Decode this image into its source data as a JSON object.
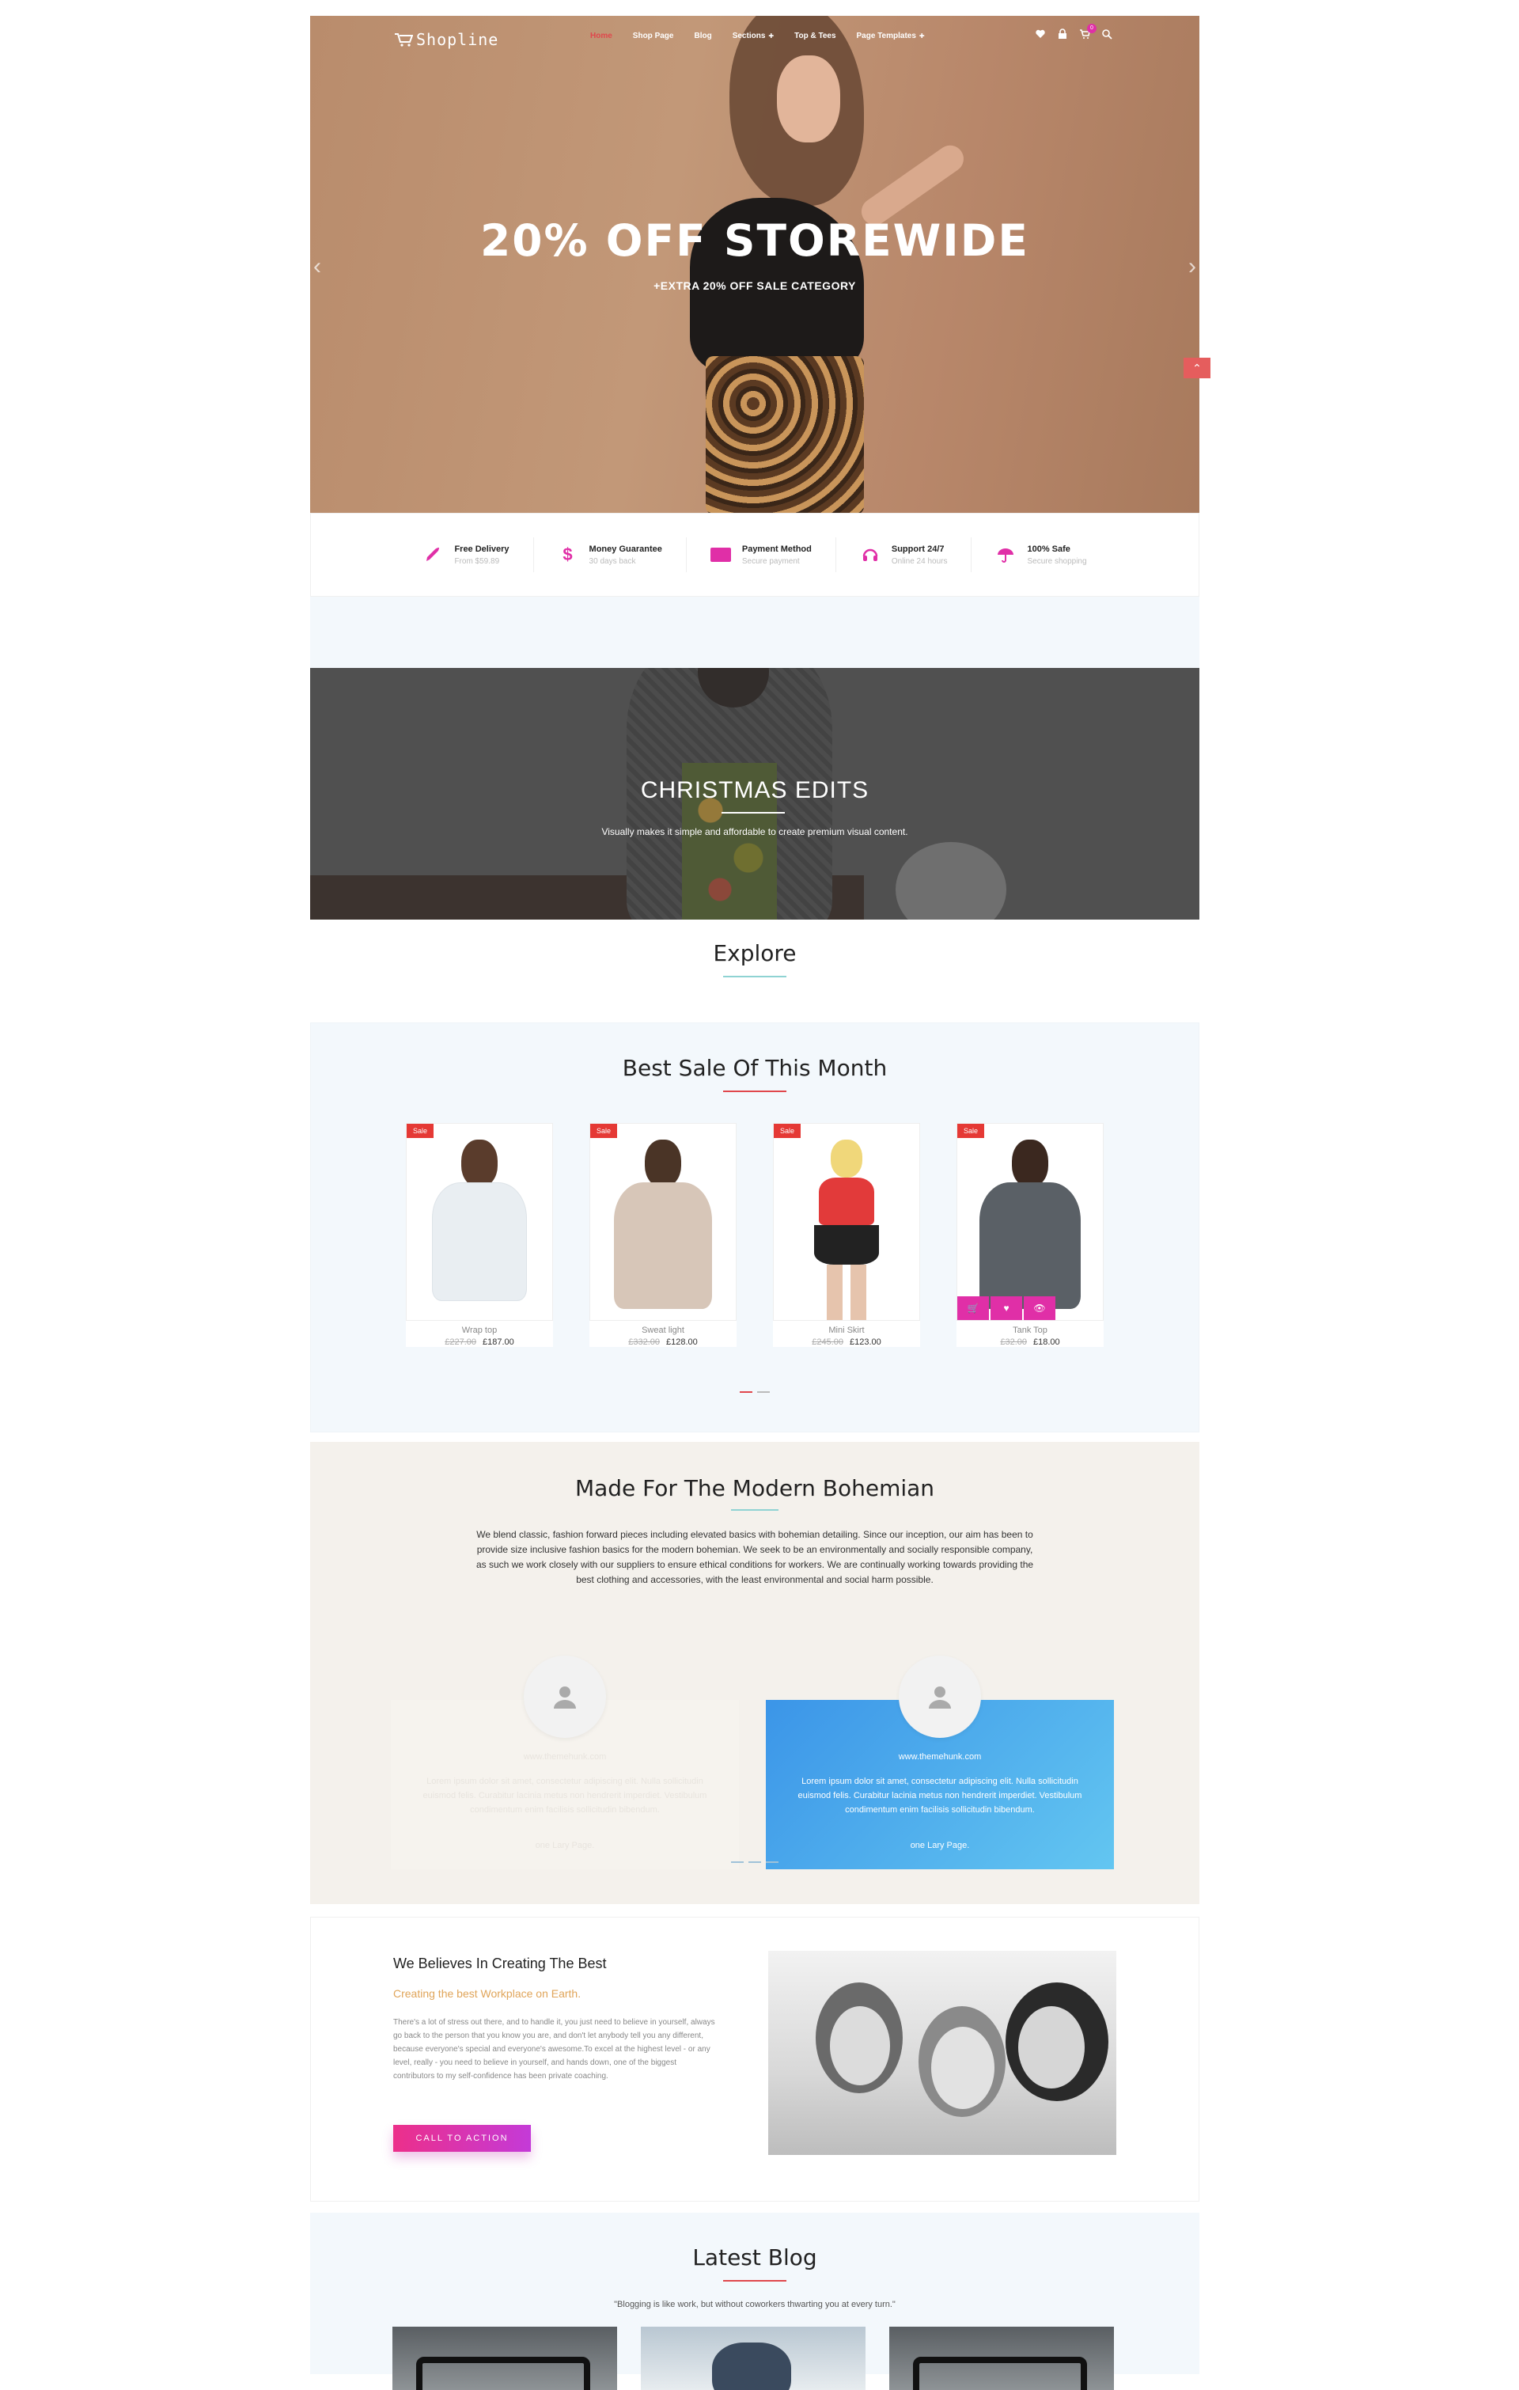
{
  "header": {
    "logo_text": "Shopline",
    "menu": [
      {
        "label": "Home",
        "active": true
      },
      {
        "label": "Shop Page"
      },
      {
        "label": "Blog"
      },
      {
        "label": "Sections",
        "has_dropdown": true
      },
      {
        "label": "Top & Tees"
      },
      {
        "label": "Page Templates",
        "has_dropdown": true
      }
    ],
    "cart_count": "0"
  },
  "hero": {
    "title": "20% OFF STOREWIDE",
    "subtitle": "+EXTRA 20% OFF SALE CATEGORY"
  },
  "features": [
    {
      "icon": "rocket-icon",
      "title": "Free Delivery",
      "sub": "From $59.89"
    },
    {
      "icon": "dollar-icon",
      "title": "Money Guarantee",
      "sub": "30 days back"
    },
    {
      "icon": "paypal-icon",
      "title": "Payment Method",
      "sub": "Secure payment"
    },
    {
      "icon": "headphones-icon",
      "title": "Support 24/7",
      "sub": "Online 24 hours"
    },
    {
      "icon": "umbrella-icon",
      "title": "100% Safe",
      "sub": "Secure shopping"
    }
  ],
  "christmas": {
    "title": "CHRISTMAS EDITS",
    "subtitle": "Visually makes it simple and affordable to create premium visual content."
  },
  "explore": {
    "title": "Explore"
  },
  "best_sale": {
    "title": "Best Sale Of This Month",
    "products": [
      {
        "badge": "Sale",
        "name": "Wrap top",
        "old_price": "£227.00",
        "price": "£187.00"
      },
      {
        "badge": "Sale",
        "name": "Sweat light",
        "old_price": "£332.00",
        "price": "£128.00"
      },
      {
        "badge": "Sale",
        "name": "Mini Skirt",
        "old_price": "£245.00",
        "price": "£123.00"
      },
      {
        "badge": "Sale",
        "name": "Tank Top",
        "old_price": "£32.00",
        "price": "£18.00"
      }
    ]
  },
  "bohemian": {
    "title": "Made For The Modern Bohemian",
    "text": "We blend classic, fashion forward pieces including elevated basics with bohemian detailing. Since our inception, our aim has been to provide size inclusive fashion basics for the modern bohemian. We seek to be an environmentally and socially responsible company, as such we work closely with our suppliers to ensure ethical conditions for workers. We are continually working towards providing the best clothing and accessories, with the least environmental and social harm possible.",
    "testimonials": [
      {
        "site": "www.themehunk.com",
        "quote": "Lorem ipsum dolor sit amet, consectetur adipiscing elit. Nulla sollicitudin euismod felis. Curabitur lacinia metus non hendrerit imperdiet. Vestibulum condimentum enim facilisis sollicitudin bibendum.",
        "who": "one Lary Page."
      },
      {
        "site": "www.themehunk.com",
        "quote": "Lorem ipsum dolor sit amet, consectetur adipiscing elit. Nulla sollicitudin euismod felis. Curabitur lacinia metus non hendrerit imperdiet. Vestibulum condimentum enim facilisis sollicitudin bibendum.",
        "who": "one Lary Page."
      }
    ]
  },
  "creating": {
    "title": "We Believes In Creating The Best",
    "subtitle": "Creating the best Workplace on Earth.",
    "text": "There's a lot of stress out there, and to handle it, you just need to believe in yourself, always go back to the person that you know you are, and don't let anybody tell you any different, because everyone's special and everyone's awesome.To excel at the highest level - or any level, really - you need to believe in yourself, and hands down, one of the biggest contributors to my self-confidence has been private coaching.",
    "cta": "CALL TO ACTION"
  },
  "blog": {
    "title": "Latest Blog",
    "subtitle": "\"Blogging is like work, but without coworkers thwarting you at every turn.\""
  },
  "colors": {
    "accent": "#e0474c",
    "pink": "#e02fa7",
    "blue": "#3b95e8"
  }
}
